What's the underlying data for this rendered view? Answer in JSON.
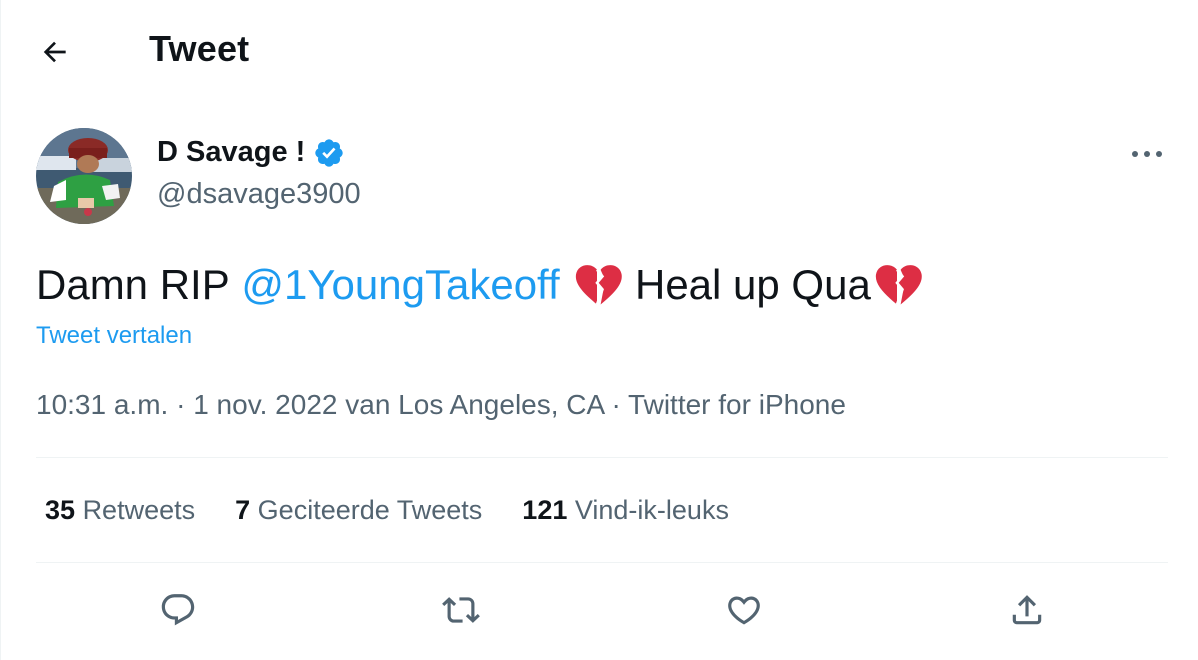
{
  "header": {
    "back_icon": "arrow-left-icon",
    "title": "Tweet"
  },
  "author": {
    "display_name": "D Savage !",
    "verified_icon": "verified-badge-icon",
    "handle": "@dsavage3900",
    "more_icon": "more-horizontal-icon"
  },
  "tweet": {
    "text_before": "Damn RIP",
    "mention": "@1YoungTakeoff",
    "emoji_1": "broken-heart-icon",
    "text_after": "Heal up Qua",
    "emoji_2": "broken-heart-icon",
    "translate_label": "Tweet vertalen",
    "time": "10:31 a.m.",
    "date": "1 nov. 2022",
    "location": "van Los Angeles, CA",
    "source": "Twitter for iPhone",
    "separator": "·"
  },
  "stats": {
    "retweets_count": "35",
    "retweets_label": "Retweets",
    "quotes_count": "7",
    "quotes_label": "Geciteerde Tweets",
    "likes_count": "121",
    "likes_label": "Vind-ik-leuks"
  },
  "actions": [
    "reply-icon",
    "retweet-icon",
    "like-icon",
    "share-icon"
  ],
  "colors": {
    "accent": "#1d9bf0",
    "text": "#0f1419",
    "secondary_text": "#536471",
    "heart": "#dd2e44"
  }
}
